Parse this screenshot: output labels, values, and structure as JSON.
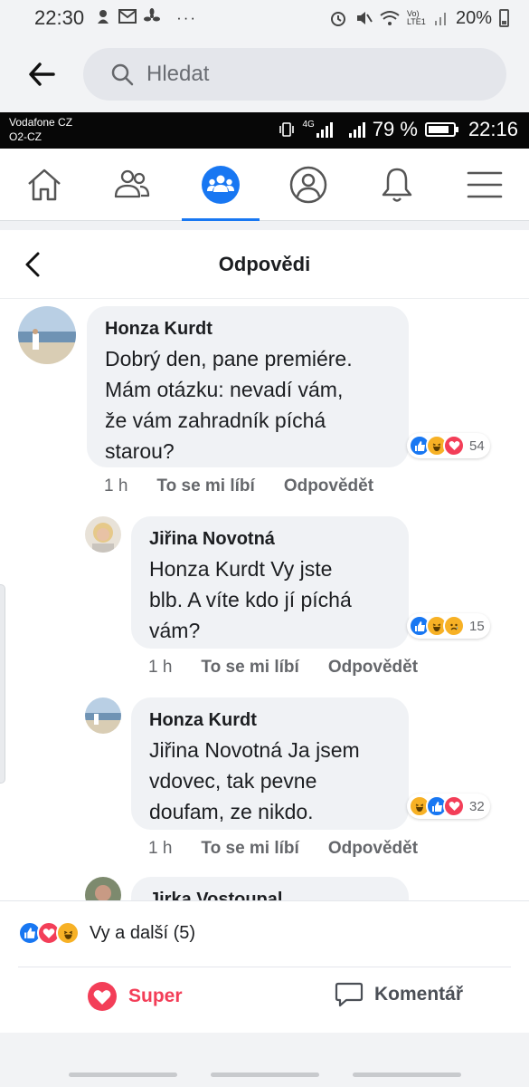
{
  "outer_status": {
    "time": "22:30",
    "battery": "20%",
    "lte": "Vo) LTE1",
    "dots": "···"
  },
  "search": {
    "placeholder": "Hledat"
  },
  "inner_status": {
    "carrier_line1": "Vodafone CZ",
    "carrier_line2": "O2-CZ",
    "network": "4G",
    "battery": "79 %",
    "time": "22:16"
  },
  "nav": {
    "tabs": [
      {
        "name": "home",
        "active": false
      },
      {
        "name": "friends",
        "active": false
      },
      {
        "name": "groups",
        "active": true
      },
      {
        "name": "profile",
        "active": false
      },
      {
        "name": "notifications",
        "active": false
      },
      {
        "name": "menu",
        "active": false
      }
    ],
    "accent_color": "#1877f2"
  },
  "panel": {
    "title": "Odpovědi"
  },
  "comments": [
    {
      "author": "Honza Kurdt",
      "lines": [
        "Dobrý den, pane premiére.",
        "Mám otázku: nevadí vám,",
        "že vám zahradník píchá",
        "starou?"
      ],
      "reactions": [
        "like",
        "haha",
        "love"
      ],
      "reaction_count": "54",
      "time": "1 h",
      "like_label": "To se mi líbí",
      "reply_label": "Odpovědět"
    },
    {
      "author": "Jiřina Novotná",
      "lines": [
        "Honza Kurdt Vy jste",
        "blb. A víte kdo jí píchá",
        "vám?"
      ],
      "reactions": [
        "like",
        "haha",
        "sad"
      ],
      "reaction_count": "15",
      "time": "1 h",
      "like_label": "To se mi líbí",
      "reply_label": "Odpovědět"
    },
    {
      "author": "Honza Kurdt",
      "lines": [
        "Jiřina Novotná Ja jsem",
        "vdovec, tak pevne",
        "doufam, ze nikdo."
      ],
      "reactions": [
        "haha",
        "like",
        "love"
      ],
      "reaction_count": "32",
      "time": "1 h",
      "like_label": "To se mi líbí",
      "reply_label": "Odpovědět"
    },
    {
      "author": "Jirka Vostoupal"
    }
  ],
  "bottom": {
    "reactions_label": "Vy a další (5)",
    "super_label": "Super",
    "comment_label": "Komentář",
    "super_color": "#f33e58"
  }
}
